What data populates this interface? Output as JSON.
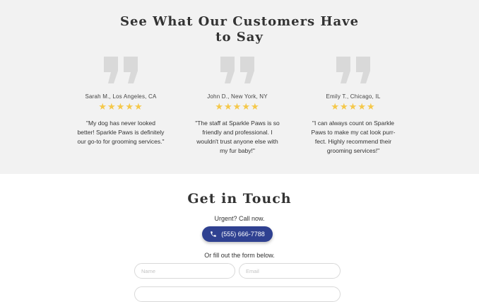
{
  "testimonials": {
    "title_line1": "See What Our Customers Have",
    "title_line2": "to Say",
    "items": [
      {
        "author": "Sarah M., Los Angeles, CA",
        "stars": "★★★★★",
        "quote": "\"My dog has never looked better! Sparkle Paws is definitely our go-to for grooming services.\""
      },
      {
        "author": "John D., New York, NY",
        "stars": "★★★★★",
        "quote": "\"The staff at Sparkle Paws is so friendly and professional. I wouldn't trust anyone else with my fur baby!\""
      },
      {
        "author": "Emily T., Chicago, IL",
        "stars": "★★★★★",
        "quote": "\"I can always count on Sparkle Paws to make my cat look purr-fect. Highly recommend their grooming services!\""
      }
    ]
  },
  "contact": {
    "title": "Get in Touch",
    "urgent_text": "Urgent? Call now.",
    "phone_label": "(555) 666-7788",
    "fill_text": "Or fill out the form below.",
    "name_placeholder": "Name",
    "email_placeholder": "Email"
  },
  "colors": {
    "accent": "#2f4191",
    "star": "#f5c84a",
    "section_bg": "#f2f2f2",
    "quote_mark": "#d9d9d9"
  },
  "icons": {
    "quote": "quote-icon",
    "star": "star-icon",
    "phone": "phone-icon"
  }
}
